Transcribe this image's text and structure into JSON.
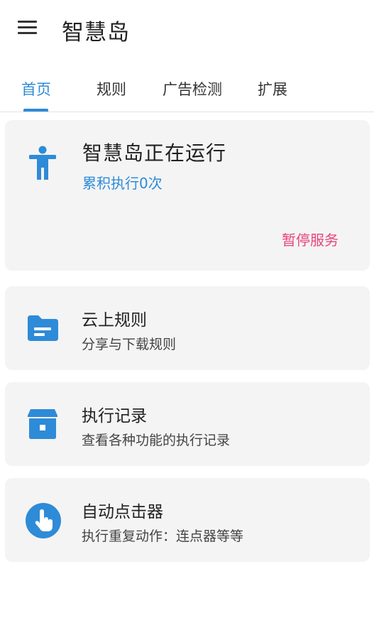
{
  "app_title": "智慧岛",
  "tabs": [
    {
      "label": "首页"
    },
    {
      "label": "规则"
    },
    {
      "label": "广告检测"
    },
    {
      "label": "扩展"
    }
  ],
  "status": {
    "title": "智慧岛正在运行",
    "count_text": "累积执行0次",
    "pause_label": "暂停服务"
  },
  "features": [
    {
      "title": "云上规则",
      "desc": "分享与下载规则",
      "icon": "folder-icon"
    },
    {
      "title": "执行记录",
      "desc": "查看各种功能的执行记录",
      "icon": "archive-icon"
    },
    {
      "title": "自动点击器",
      "desc": "执行重复动作：连点器等等",
      "icon": "touch-icon"
    }
  ],
  "colors": {
    "accent": "#2e8bd8",
    "pause": "#e8457a",
    "card_bg": "#f4f4f4"
  }
}
